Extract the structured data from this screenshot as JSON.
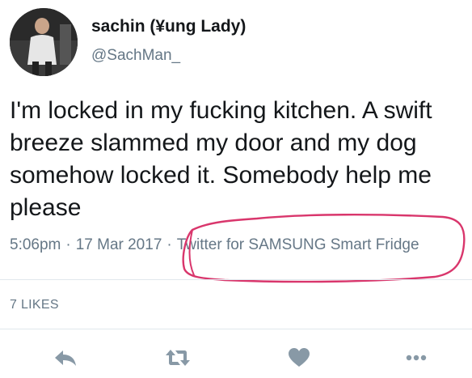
{
  "user": {
    "display_name": "sachin (¥ung Lady)",
    "handle": "@SachMan_"
  },
  "tweet": {
    "text": "I'm locked in my fucking kitchen. A swift breeze slammed my door and my dog somehow locked it. Somebody help me please",
    "time": "5:06pm",
    "date": "17 Mar 2017",
    "separator": "·",
    "source": "Twitter for SAMSUNG Smart Fridge",
    "likes": "7 LIKES"
  },
  "icons": {
    "avatar": "profile-photo",
    "reply": "reply-icon",
    "retweet": "retweet-icon",
    "like": "heart-icon",
    "more": "more-dots-icon"
  },
  "colors": {
    "text": "#14171a",
    "secondary": "#657786",
    "icon": "#8899a6",
    "annotation": "#d9366c",
    "divider": "#e1e8ed"
  }
}
